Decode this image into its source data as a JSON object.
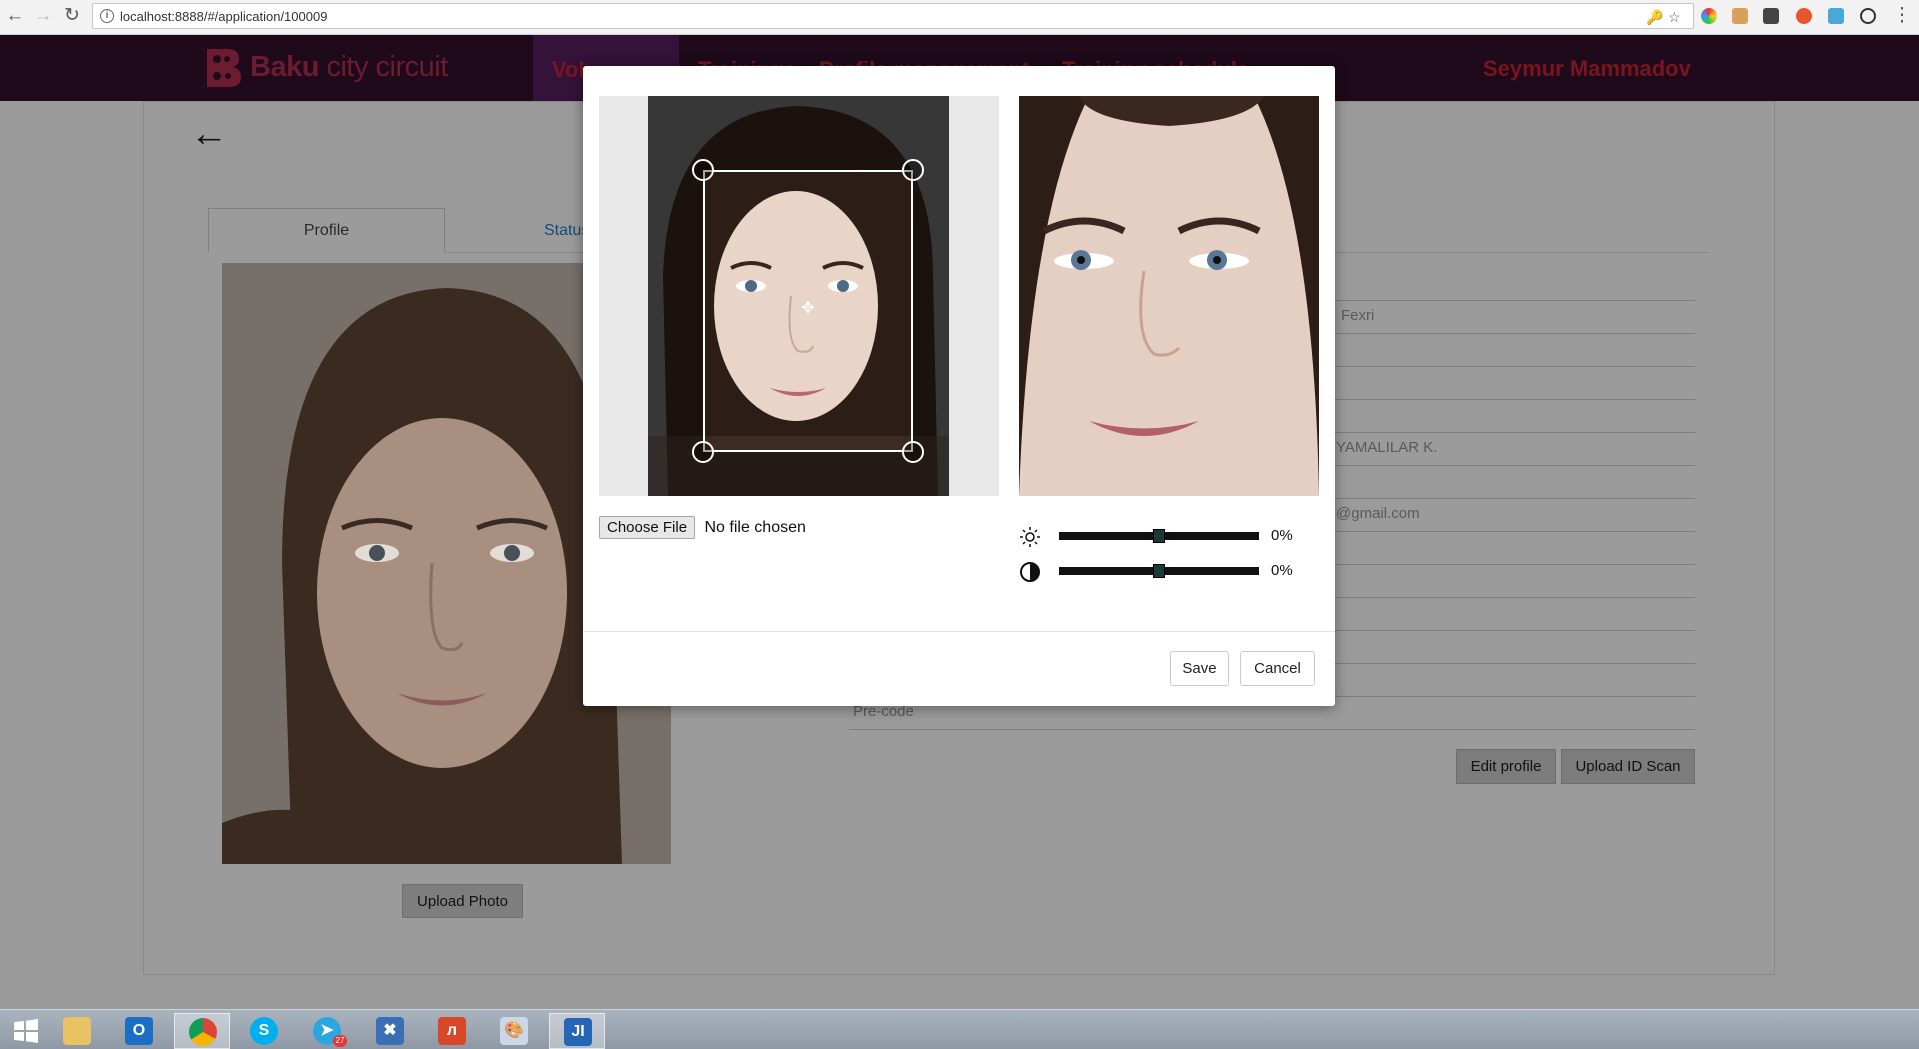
{
  "browser": {
    "url": "localhost:8888/#/application/100009",
    "icons": [
      "back-icon",
      "forward-icon",
      "reload-icon",
      "info-icon",
      "key-icon",
      "star-icon"
    ]
  },
  "header": {
    "logo_bold": "Baku",
    "logo_light": "city circuit",
    "nav": [
      "Vol",
      "Trainings",
      "Profile management",
      "Training schedule"
    ],
    "user_name": "Seymur Mammadov"
  },
  "profile_page": {
    "tabs": [
      "Profile",
      "Status"
    ],
    "upload_photo_label": "Upload Photo",
    "field_values": [
      "Fexri",
      "YAMALILAR K.",
      "@gmail.com",
      "Pre-code"
    ],
    "edit_profile_label": "Edit profile",
    "upload_id_label": "Upload ID Scan"
  },
  "cropper_modal": {
    "choose_file_label": "Choose File",
    "file_status": "No file chosen",
    "brightness_value": "0%",
    "contrast_value": "0%",
    "brightness_level": 0.5,
    "contrast_level": 0.5,
    "save_label": "Save",
    "cancel_label": "Cancel"
  },
  "taskbar": {
    "apps": [
      "start",
      "explorer",
      "outlook",
      "chrome",
      "skype",
      "telegram",
      "tools",
      "acrobat",
      "paint",
      "jetbrains"
    ],
    "telegram_badge": "27"
  },
  "colors": {
    "header_bg": "#1e0a1a",
    "brand_red": "#7a1520",
    "overlay": "#9b9b9b"
  }
}
